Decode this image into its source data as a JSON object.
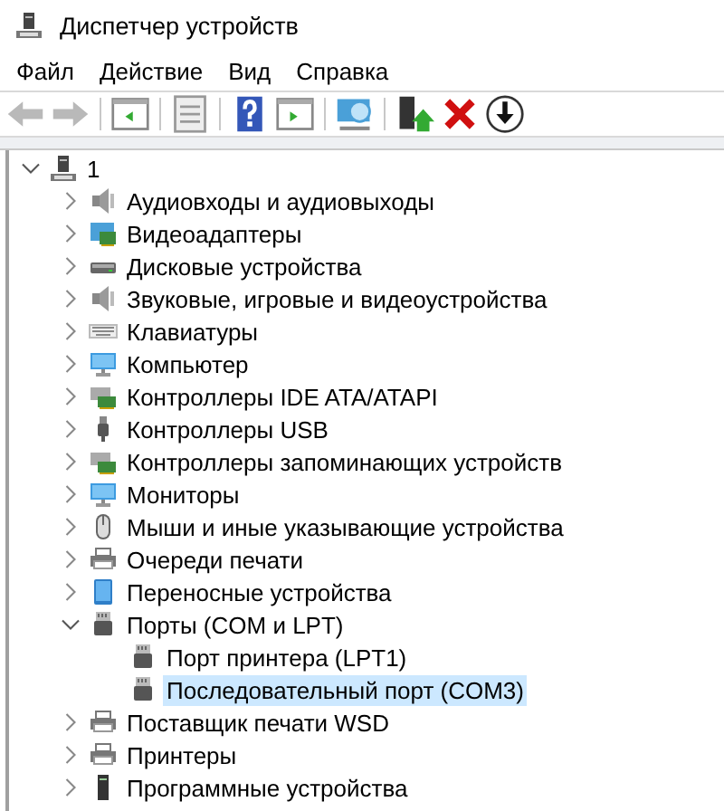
{
  "window": {
    "title": "Диспетчер устройств"
  },
  "menu": [
    "Файл",
    "Действие",
    "Вид",
    "Справка"
  ],
  "toolbar": [
    {
      "kind": "back",
      "disabled": true
    },
    {
      "kind": "forward",
      "disabled": true
    },
    {
      "kind": "separator"
    },
    {
      "kind": "tree-view",
      "disabled": false
    },
    {
      "kind": "separator"
    },
    {
      "kind": "properties",
      "disabled": false
    },
    {
      "kind": "separator"
    },
    {
      "kind": "help",
      "disabled": false
    },
    {
      "kind": "pane",
      "disabled": false
    },
    {
      "kind": "separator"
    },
    {
      "kind": "scan",
      "disabled": false
    },
    {
      "kind": "separator"
    },
    {
      "kind": "update",
      "disabled": false
    },
    {
      "kind": "remove",
      "disabled": false
    },
    {
      "kind": "download",
      "disabled": false
    }
  ],
  "tree": {
    "label": "1",
    "kind": "computer-node",
    "expanded": true,
    "selected": false,
    "children": [
      {
        "label": "Аудиовходы и аудиовыходы",
        "kind": "speaker",
        "expanded": false,
        "selected": false
      },
      {
        "label": "Видеоадаптеры",
        "kind": "card",
        "expanded": false,
        "selected": false
      },
      {
        "label": "Дисковые устройства",
        "kind": "disk",
        "expanded": false,
        "selected": false
      },
      {
        "label": "Звуковые, игровые и видеоустройства",
        "kind": "speaker",
        "expanded": false,
        "selected": false
      },
      {
        "label": "Клавиатуры",
        "kind": "keyboard",
        "expanded": false,
        "selected": false
      },
      {
        "label": "Компьютер",
        "kind": "monitor",
        "expanded": false,
        "selected": false
      },
      {
        "label": "Контроллеры IDE ATA/ATAPI",
        "kind": "controller",
        "expanded": false,
        "selected": false
      },
      {
        "label": "Контроллеры USB",
        "kind": "usb",
        "expanded": false,
        "selected": false
      },
      {
        "label": "Контроллеры запоминающих устройств",
        "kind": "controller",
        "expanded": false,
        "selected": false
      },
      {
        "label": "Мониторы",
        "kind": "monitor",
        "expanded": false,
        "selected": false
      },
      {
        "label": "Мыши и иные указывающие устройства",
        "kind": "mouse",
        "expanded": false,
        "selected": false
      },
      {
        "label": "Очереди печати",
        "kind": "printer",
        "expanded": false,
        "selected": false
      },
      {
        "label": "Переносные устройства",
        "kind": "tablet",
        "expanded": false,
        "selected": false
      },
      {
        "label": "Порты (COM и LPT)",
        "kind": "port",
        "expanded": true,
        "selected": false,
        "children": [
          {
            "label": "Порт принтера (LPT1)",
            "kind": "port",
            "selected": false
          },
          {
            "label": "Последовательный порт (COM3)",
            "kind": "port",
            "selected": true
          }
        ]
      },
      {
        "label": "Поставщик печати WSD",
        "kind": "printer",
        "expanded": false,
        "selected": false
      },
      {
        "label": "Принтеры",
        "kind": "printer",
        "expanded": false,
        "selected": false
      },
      {
        "label": "Программные устройства",
        "kind": "tower",
        "expanded": false,
        "selected": false
      }
    ]
  }
}
